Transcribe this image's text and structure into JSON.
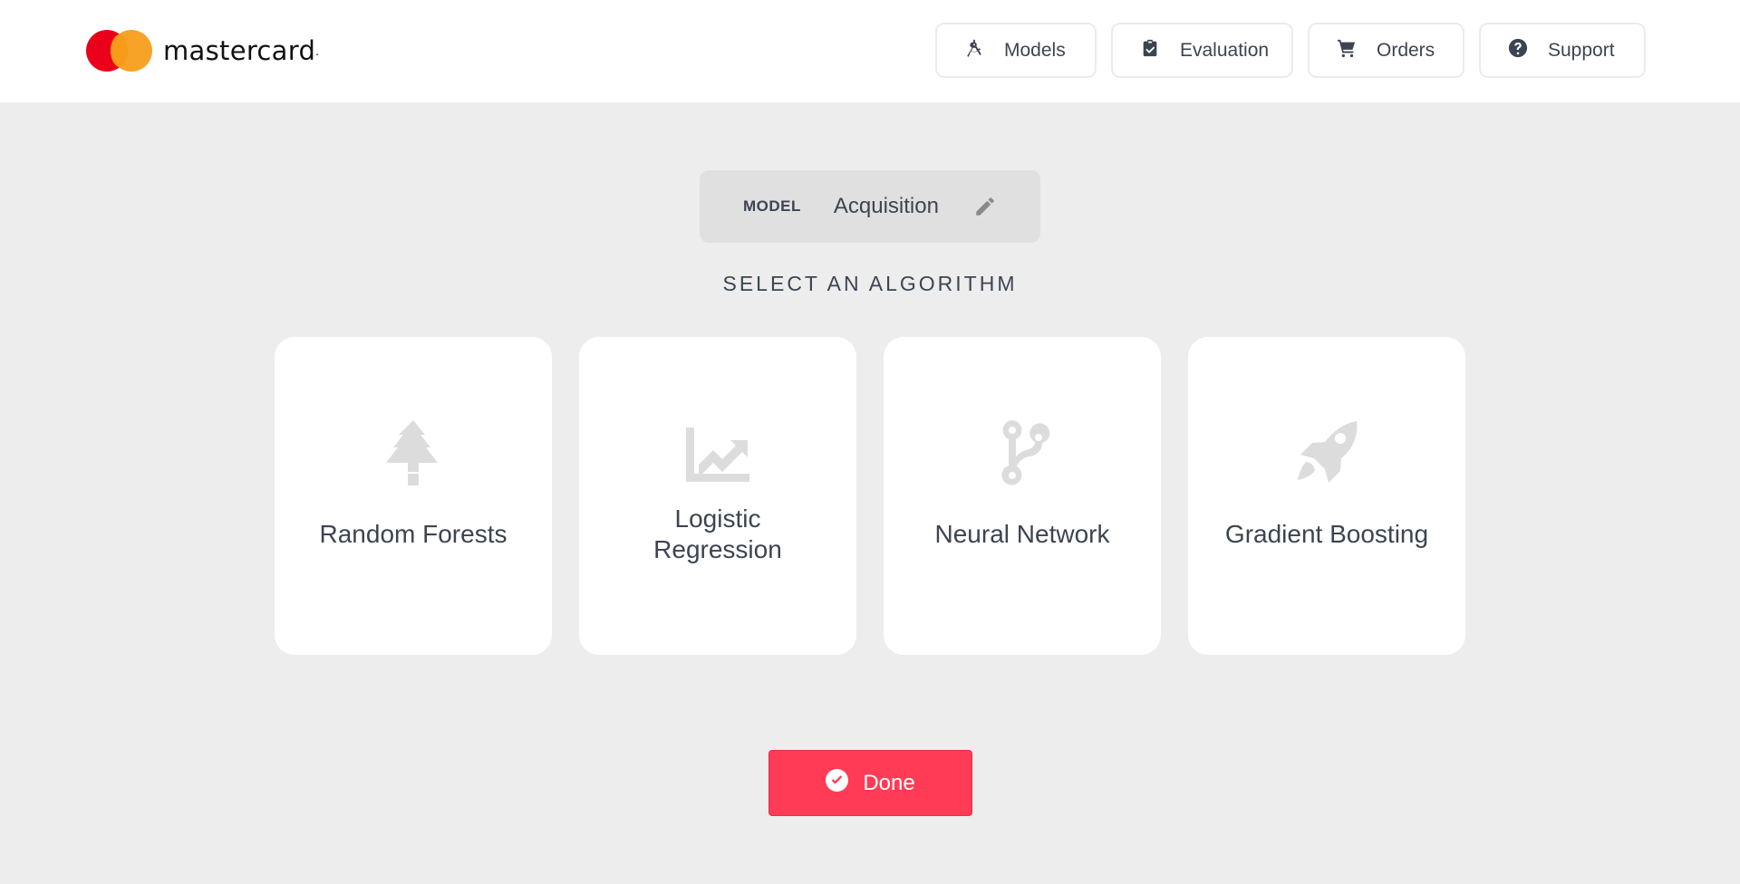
{
  "brand": {
    "name": "mastercard",
    "mark": "."
  },
  "nav": [
    {
      "label": "Models",
      "icon": "compass-drafting-icon"
    },
    {
      "label": "Evaluation",
      "icon": "clipboard-check-icon"
    },
    {
      "label": "Orders",
      "icon": "shopping-cart-icon"
    },
    {
      "label": "Support",
      "icon": "question-circle-icon"
    }
  ],
  "model": {
    "label": "MODEL",
    "name": "Acquisition"
  },
  "section": {
    "heading": "SELECT AN ALGORITHM"
  },
  "algorithms": [
    {
      "label": "Random Forests",
      "icon": "tree-icon"
    },
    {
      "label": "Logistic",
      "label2": "Regression",
      "icon": "chart-area-icon"
    },
    {
      "label": "Neural Network",
      "icon": "code-branch-icon"
    },
    {
      "label": "Gradient Boosting",
      "icon": "rocket-icon"
    }
  ],
  "actions": {
    "done_label": "Done"
  },
  "colors": {
    "accent": "#ff3b55",
    "text": "#3d4451",
    "background": "#ededed",
    "icon_muted": "#dcdcdc"
  }
}
